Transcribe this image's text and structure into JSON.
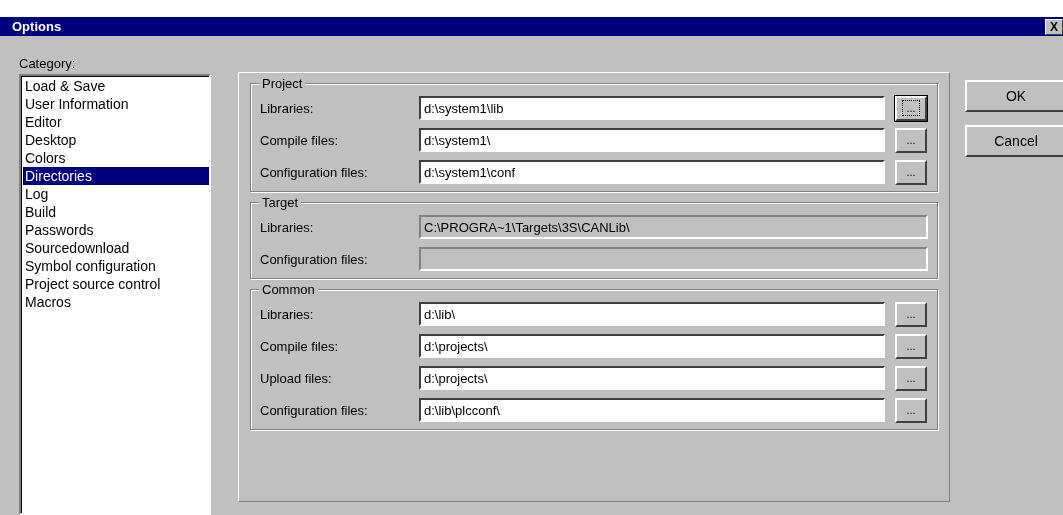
{
  "window": {
    "title": "Options",
    "close_button": "X"
  },
  "category": {
    "label": "Category:",
    "items": [
      {
        "label": "Load & Save",
        "selected": false
      },
      {
        "label": "User Information",
        "selected": false
      },
      {
        "label": "Editor",
        "selected": false
      },
      {
        "label": "Desktop",
        "selected": false
      },
      {
        "label": "Colors",
        "selected": false
      },
      {
        "label": "Directories",
        "selected": true
      },
      {
        "label": "Log",
        "selected": false
      },
      {
        "label": "Build",
        "selected": false
      },
      {
        "label": "Passwords",
        "selected": false
      },
      {
        "label": "Sourcedownload",
        "selected": false
      },
      {
        "label": "Symbol configuration",
        "selected": false
      },
      {
        "label": "Project source control",
        "selected": false
      },
      {
        "label": "Macros",
        "selected": false
      }
    ]
  },
  "groups": [
    {
      "title": "Project",
      "fields": [
        {
          "label": "Libraries:",
          "value": "d:\\system1\\lib",
          "disabled": false,
          "browse_button": {
            "label": "...",
            "focused": true
          }
        },
        {
          "label": "Compile files:",
          "value": "d:\\system1\\",
          "disabled": false,
          "browse_button": {
            "label": "...",
            "focused": false
          }
        },
        {
          "label": "Configuration files:",
          "value": "d:\\system1\\conf",
          "disabled": false,
          "browse_button": {
            "label": "...",
            "focused": false
          }
        }
      ]
    },
    {
      "title": "Target",
      "fields": [
        {
          "label": "Libraries:",
          "value": "C:\\PROGRA~1\\Targets\\3S\\CANLib\\",
          "disabled": true
        },
        {
          "label": "Configuration files:",
          "disabled": true
        }
      ]
    },
    {
      "title": "Common",
      "fields": [
        {
          "label": "Libraries:",
          "value": "d:\\lib\\",
          "disabled": false,
          "browse_button": {
            "label": "...",
            "focused": false
          }
        },
        {
          "label": "Compile files:",
          "value": "d:\\projects\\",
          "disabled": false,
          "browse_button": {
            "label": "...",
            "focused": false
          }
        },
        {
          "label": "Upload files:",
          "value": "d:\\projects\\",
          "disabled": false,
          "browse_button": {
            "label": "...",
            "focused": false
          }
        },
        {
          "label": "Configuration files:",
          "value": "d:\\lib\\plcconf\\",
          "disabled": false,
          "browse_button": {
            "label": "...",
            "focused": false
          }
        }
      ]
    }
  ],
  "buttons": [
    "OK",
    "Cancel"
  ]
}
